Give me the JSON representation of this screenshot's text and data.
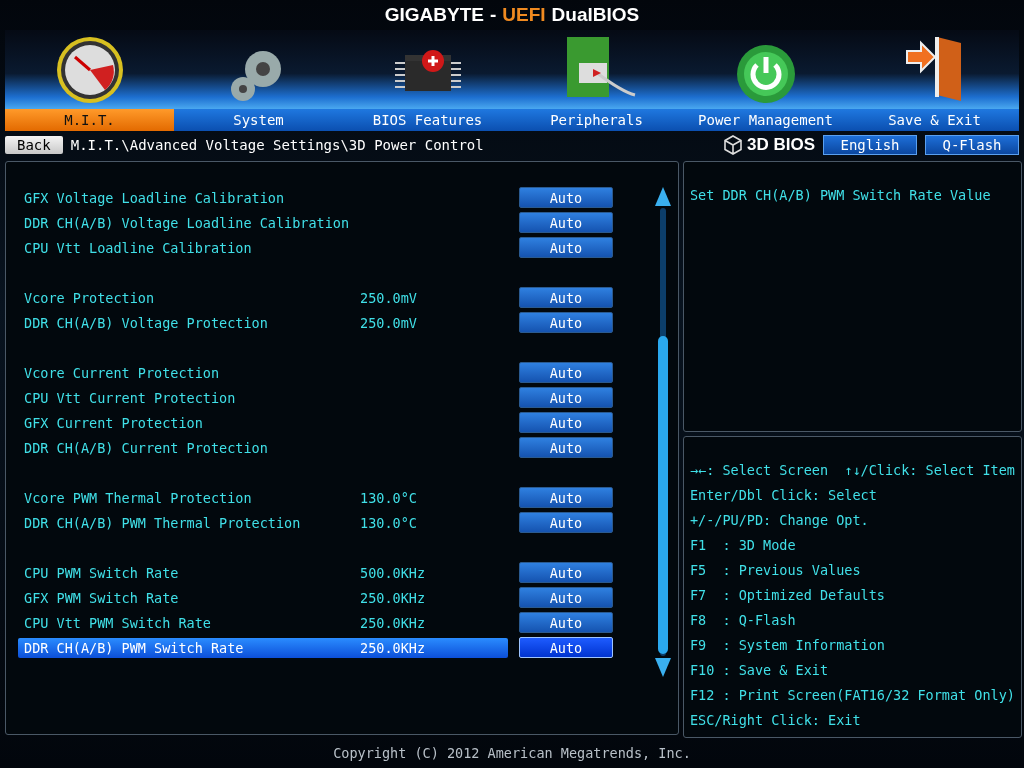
{
  "header": {
    "brand": "GIGABYTE",
    "separator": "-",
    "accent": "UEFI",
    "product": "DualBIOS"
  },
  "tabs": [
    {
      "label": "M.I.T.",
      "kind": "gauge",
      "selected": true
    },
    {
      "label": "System",
      "kind": "gear",
      "selected": false
    },
    {
      "label": "BIOS Features",
      "kind": "chip",
      "selected": false
    },
    {
      "label": "Peripherals",
      "kind": "card",
      "selected": false
    },
    {
      "label": "Power Management",
      "kind": "power",
      "selected": false
    },
    {
      "label": "Save & Exit",
      "kind": "door",
      "selected": false
    }
  ],
  "nav": {
    "back": "Back",
    "path": "M.I.T.\\Advanced Voltage Settings\\3D Power Control",
    "logo": "3D BIOS",
    "language": "English",
    "qflash": "Q-Flash"
  },
  "groups": [
    {
      "rows": [
        {
          "label": "GFX Voltage Loadline Calibration",
          "option": "Auto",
          "selected": false
        },
        {
          "label": "DDR CH(A/B) Voltage Loadline Calibration",
          "option": "Auto",
          "selected": false
        },
        {
          "label": "CPU Vtt Loadline Calibration",
          "option": "Auto",
          "selected": false
        }
      ]
    },
    {
      "rows": [
        {
          "label": "Vcore Protection",
          "value": "250.0mV",
          "option": "Auto",
          "selected": false
        },
        {
          "label": "DDR CH(A/B) Voltage Protection",
          "value": "250.0mV",
          "option": "Auto",
          "selected": false
        }
      ]
    },
    {
      "rows": [
        {
          "label": "Vcore Current Protection",
          "option": "Auto",
          "selected": false
        },
        {
          "label": "CPU Vtt Current Protection",
          "option": "Auto",
          "selected": false
        },
        {
          "label": "GFX Current Protection",
          "option": "Auto",
          "selected": false
        },
        {
          "label": "DDR CH(A/B) Current Protection",
          "option": "Auto",
          "selected": false
        }
      ]
    },
    {
      "rows": [
        {
          "label": "Vcore PWM Thermal Protection",
          "value": "130.0°C",
          "option": "Auto",
          "selected": false
        },
        {
          "label": "DDR CH(A/B) PWM Thermal Protection",
          "value": "130.0°C",
          "option": "Auto",
          "selected": false
        }
      ]
    },
    {
      "rows": [
        {
          "label": "CPU PWM Switch Rate",
          "value": "500.0KHz",
          "option": "Auto",
          "selected": false
        },
        {
          "label": "GFX PWM Switch Rate",
          "value": "250.0KHz",
          "option": "Auto",
          "selected": false
        },
        {
          "label": "CPU Vtt PWM Switch Rate",
          "value": "250.0KHz",
          "option": "Auto",
          "selected": false
        },
        {
          "label": "DDR CH(A/B) PWM Switch Rate",
          "value": "250.0KHz",
          "option": "Auto",
          "selected": true
        }
      ]
    }
  ],
  "description": "Set DDR CH(A/B) PWM Switch Rate Value",
  "help": [
    "→←: Select Screen  ↑↓/Click: Select Item",
    "Enter/Dbl Click: Select",
    "+/-/PU/PD: Change Opt.",
    "F1  : 3D Mode",
    "F5  : Previous Values",
    "F7  : Optimized Defaults",
    "F8  : Q-Flash",
    "F9  : System Information",
    "F10 : Save & Exit",
    "F12 : Print Screen(FAT16/32 Format Only)",
    "ESC/Right Click: Exit"
  ],
  "footer": "Copyright (C) 2012 American Megatrends, Inc."
}
